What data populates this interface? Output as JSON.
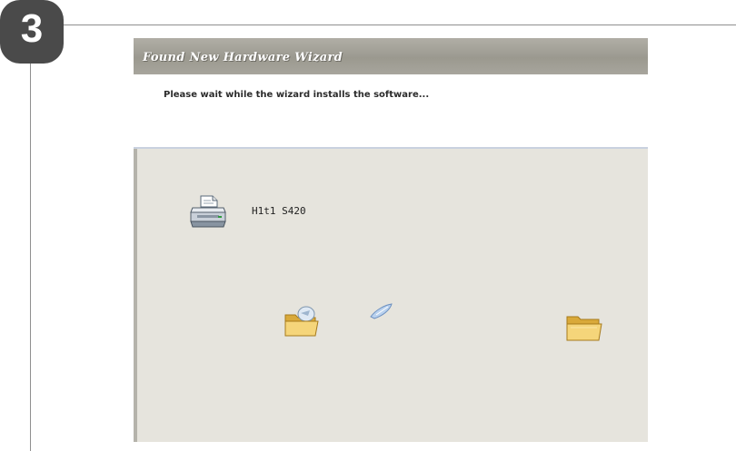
{
  "step_number": "3",
  "wizard": {
    "title": "Found New Hardware Wizard",
    "header_message": "Please wait while the wizard installs the software...",
    "device_name": "H1t1 S420"
  },
  "icons": {
    "device": "printer-icon",
    "source": "folder-open-icon",
    "transfer": "flying-document-icon",
    "destination": "folder-open-icon"
  },
  "colors": {
    "badge": "#4a4a4a",
    "titlebar": "#a6a49c",
    "dialog_body": "#e6e4dd",
    "header_background": "#ffffff",
    "folder": "#f2cf6a"
  }
}
